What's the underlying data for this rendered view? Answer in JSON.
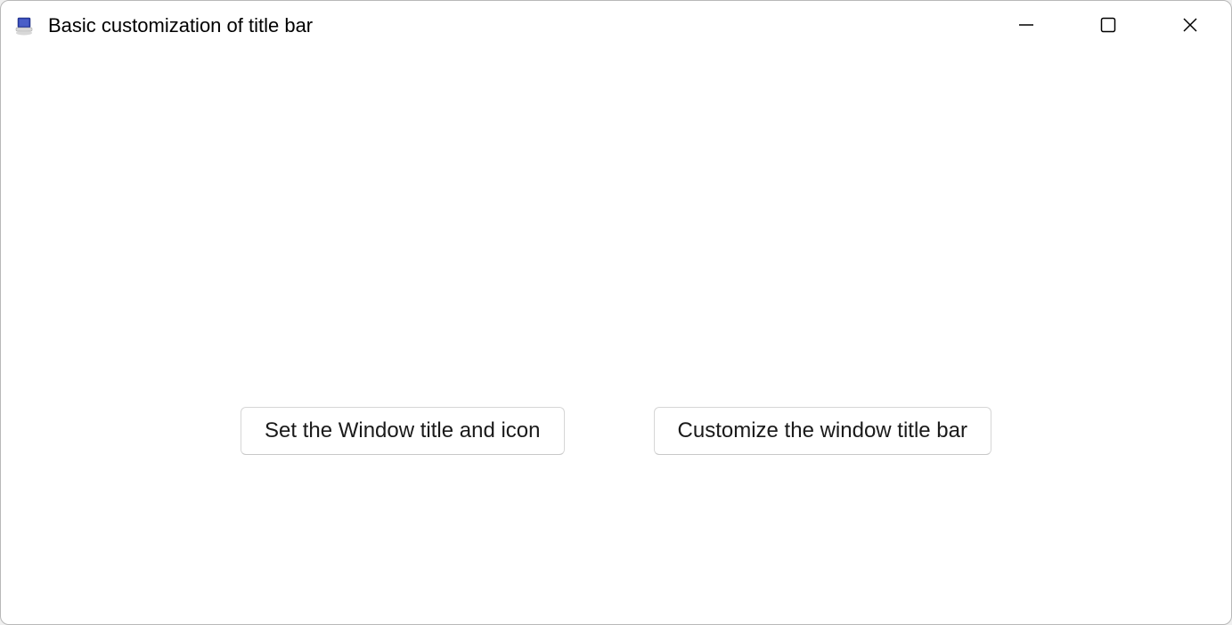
{
  "window": {
    "title": "Basic customization of title bar",
    "icon_name": "app-icon"
  },
  "content": {
    "buttons": [
      {
        "label": "Set the Window title and icon"
      },
      {
        "label": "Customize the window title bar"
      }
    ]
  }
}
